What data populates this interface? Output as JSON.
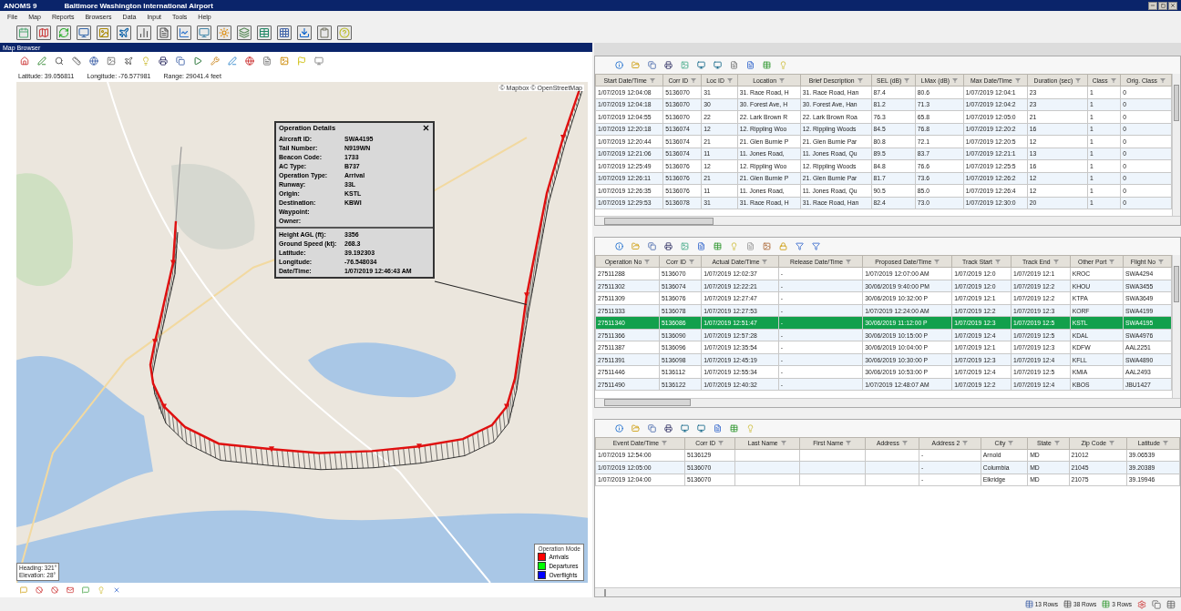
{
  "window": {
    "title": "ANOMS 9",
    "subtitle": "Baltimore Washington International Airport"
  },
  "menu": [
    "File",
    "Map",
    "Reports",
    "Browsers",
    "Data",
    "Input",
    "Tools",
    "Help"
  ],
  "map_browser": {
    "title": "Map Browser",
    "coordinates": [
      "Latitude: 39.056811",
      "Longitude: -76.577981",
      "Range: 29041.4 feet"
    ],
    "attribution": "© Mapbox © OpenStreetMap",
    "popup": {
      "title": "Operation Details",
      "sections": [
        [
          {
            "label": "Aircraft ID:",
            "value": "SWA4195"
          },
          {
            "label": "Tail Number:",
            "value": "N919WN"
          },
          {
            "label": "Beacon Code:",
            "value": "1733"
          },
          {
            "label": "AC Type:",
            "value": "B737"
          },
          {
            "label": "Operation Type:",
            "value": "Arrival"
          },
          {
            "label": "Runway:",
            "value": "33L"
          },
          {
            "label": "Origin:",
            "value": "KSTL"
          },
          {
            "label": "Destination:",
            "value": "KBWI"
          },
          {
            "label": "Waypoint:"
          },
          {
            "label": "Owner:"
          }
        ],
        [
          {
            "label": "Height AGL (ft):",
            "value": "3356"
          },
          {
            "label": "Ground Speed (kt):",
            "value": "268.3"
          },
          {
            "label": "Latitude:",
            "value": "39.192303"
          },
          {
            "label": "Longitude:",
            "value": "-76.548034"
          },
          {
            "label": "Date/Time:",
            "value": "1/07/2019 12:46:43 AM"
          }
        ]
      ]
    },
    "view_info": [
      "Heading: 321°",
      "Elevation: 28°"
    ],
    "legend": {
      "title": "Operation Mode",
      "items": [
        {
          "label": "Arrivals",
          "color": "#ff0000"
        },
        {
          "label": "Departures",
          "color": "#00ff00"
        },
        {
          "label": "Overflights",
          "color": "#0000ff"
        }
      ]
    }
  },
  "grids": [
    {
      "columns": [
        "Start Date/Time",
        "Corr ID",
        "Loc ID",
        "Location",
        "Brief Description",
        "SEL (dB)",
        "LMax (dB)",
        "Max Date/Time",
        "Duration (sec)",
        "Class",
        "Orig. Class"
      ],
      "rows": [
        {
          "selected": false,
          "cells": [
            "1/07/2019 12:04:08",
            "5136070",
            "31",
            "31. Race Road, H",
            "31. Race Road, Han",
            "87.4",
            "80.6",
            "1/07/2019 12:04:1",
            "23",
            "1",
            "0"
          ]
        },
        {
          "selected": false,
          "cells": [
            "1/07/2019 12:04:18",
            "5136070",
            "30",
            "30. Forest Ave, H",
            "30. Forest Ave, Han",
            "81.2",
            "71.3",
            "1/07/2019 12:04:2",
            "23",
            "1",
            "0"
          ]
        },
        {
          "selected": false,
          "cells": [
            "1/07/2019 12:04:55",
            "5136070",
            "22",
            "22. Lark Brown R",
            "22. Lark Brown Roa",
            "76.3",
            "65.8",
            "1/07/2019 12:05:0",
            "21",
            "1",
            "0"
          ]
        },
        {
          "selected": false,
          "cells": [
            "1/07/2019 12:20:18",
            "5136074",
            "12",
            "12. Rippling Woo",
            "12. Rippling Woods",
            "84.5",
            "76.8",
            "1/07/2019 12:20:2",
            "16",
            "1",
            "0"
          ]
        },
        {
          "selected": false,
          "cells": [
            "1/07/2019 12:20:44",
            "5136074",
            "21",
            "21. Glen Burnie P",
            "21. Glen Burnie Par",
            "80.8",
            "72.1",
            "1/07/2019 12:20:5",
            "12",
            "1",
            "0"
          ]
        },
        {
          "selected": false,
          "cells": [
            "1/07/2019 12:21:06",
            "5136074",
            "11",
            "11. Jones Road,",
            "11. Jones Road, Qu",
            "89.5",
            "83.7",
            "1/07/2019 12:21:1",
            "13",
            "1",
            "0"
          ]
        },
        {
          "selected": false,
          "cells": [
            "1/07/2019 12:25:49",
            "5136076",
            "12",
            "12. Rippling Woo",
            "12. Rippling Woods",
            "84.8",
            "76.6",
            "1/07/2019 12:25:5",
            "16",
            "1",
            "0"
          ]
        },
        {
          "selected": false,
          "cells": [
            "1/07/2019 12:26:11",
            "5136076",
            "21",
            "21. Glen Burnie P",
            "21. Glen Burnie Par",
            "81.7",
            "73.6",
            "1/07/2019 12:26:2",
            "12",
            "1",
            "0"
          ]
        },
        {
          "selected": false,
          "cells": [
            "1/07/2019 12:26:35",
            "5136076",
            "11",
            "11. Jones Road,",
            "11. Jones Road, Qu",
            "90.5",
            "85.0",
            "1/07/2019 12:26:4",
            "12",
            "1",
            "0"
          ]
        },
        {
          "selected": false,
          "cells": [
            "1/07/2019 12:29:53",
            "5136078",
            "31",
            "31. Race Road, H",
            "31. Race Road, Han",
            "82.4",
            "73.0",
            "1/07/2019 12:30:0",
            "20",
            "1",
            "0"
          ]
        }
      ]
    },
    {
      "columns": [
        "Operation No",
        "Corr ID",
        "Actual Date/Time",
        "Release Date/Time",
        "Proposed Date/Time",
        "Track Start",
        "Track End",
        "Other Port",
        "Flight No"
      ],
      "rows": [
        {
          "selected": false,
          "cells": [
            "27511288",
            "5136070",
            "1/07/2019 12:02:37",
            "-",
            "1/07/2019 12:07:00 AM",
            "1/07/2019 12:0",
            "1/07/2019 12:1",
            "KROC",
            "SWA4294"
          ]
        },
        {
          "selected": false,
          "cells": [
            "27511302",
            "5136074",
            "1/07/2019 12:22:21",
            "-",
            "30/06/2019 9:40:00 PM",
            "1/07/2019 12:0",
            "1/07/2019 12:2",
            "KHOU",
            "SWA3455"
          ]
        },
        {
          "selected": false,
          "cells": [
            "27511309",
            "5136076",
            "1/07/2019 12:27:47",
            "-",
            "30/06/2019 10:32:00 P",
            "1/07/2019 12:1",
            "1/07/2019 12:2",
            "KTPA",
            "SWA3649"
          ]
        },
        {
          "selected": false,
          "cells": [
            "27511333",
            "5136078",
            "1/07/2019 12:27:53",
            "-",
            "1/07/2019 12:24:00 AM",
            "1/07/2019 12:2",
            "1/07/2019 12:3",
            "KORF",
            "SWA4199"
          ]
        },
        {
          "selected": true,
          "cells": [
            "27511340",
            "5136086",
            "1/07/2019 12:51:47",
            "-",
            "30/06/2019 11:12:00 P",
            "1/07/2019 12:3",
            "1/07/2019 12:5",
            "KSTL",
            "SWA4195"
          ]
        },
        {
          "selected": false,
          "cells": [
            "27511366",
            "5136090",
            "1/07/2019 12:57:28",
            "-",
            "30/06/2019 10:15:00 P",
            "1/07/2019 12:4",
            "1/07/2019 12:5",
            "KDAL",
            "SWA4976"
          ]
        },
        {
          "selected": false,
          "cells": [
            "27511387",
            "5136096",
            "1/07/2019 12:35:54",
            "-",
            "30/06/2019 10:04:00 P",
            "1/07/2019 12:1",
            "1/07/2019 12:3",
            "KDFW",
            "AAL2251"
          ]
        },
        {
          "selected": false,
          "cells": [
            "27511391",
            "5136098",
            "1/07/2019 12:45:19",
            "-",
            "30/06/2019 10:30:00 P",
            "1/07/2019 12:3",
            "1/07/2019 12:4",
            "KFLL",
            "SWA4890"
          ]
        },
        {
          "selected": false,
          "cells": [
            "27511446",
            "5136112",
            "1/07/2019 12:55:34",
            "-",
            "30/06/2019 10:53:00 P",
            "1/07/2019 12:4",
            "1/07/2019 12:5",
            "KMIA",
            "AAL2493"
          ]
        },
        {
          "selected": false,
          "cells": [
            "27511490",
            "5136122",
            "1/07/2019 12:40:32",
            "-",
            "1/07/2019 12:48:07 AM",
            "1/07/2019 12:2",
            "1/07/2019 12:4",
            "KBOS",
            "JBU1427"
          ]
        }
      ]
    },
    {
      "columns": [
        "Event Date/Time",
        "Corr ID",
        "Last Name",
        "First Name",
        "Address",
        "Address 2",
        "City",
        "State",
        "Zip Code",
        "Latitude"
      ],
      "rows": [
        {
          "selected": false,
          "cells": [
            "1/07/2019 12:54:00",
            "5136129",
            "",
            "",
            "",
            "-",
            "Arnold",
            "MD",
            "21012",
            "39.06539"
          ]
        },
        {
          "selected": false,
          "cells": [
            "1/07/2019 12:05:00",
            "5136070",
            "",
            "",
            "",
            "-",
            "Columbia",
            "MD",
            "21045",
            "39.20389"
          ]
        },
        {
          "selected": false,
          "cells": [
            "1/07/2019 12:04:00",
            "5136070",
            "",
            "",
            "",
            "-",
            "Elkridge",
            "MD",
            "21075",
            "39.19946"
          ]
        }
      ]
    }
  ],
  "status_bar": [
    "13 Rows",
    "38 Rows",
    "3 Rows"
  ]
}
